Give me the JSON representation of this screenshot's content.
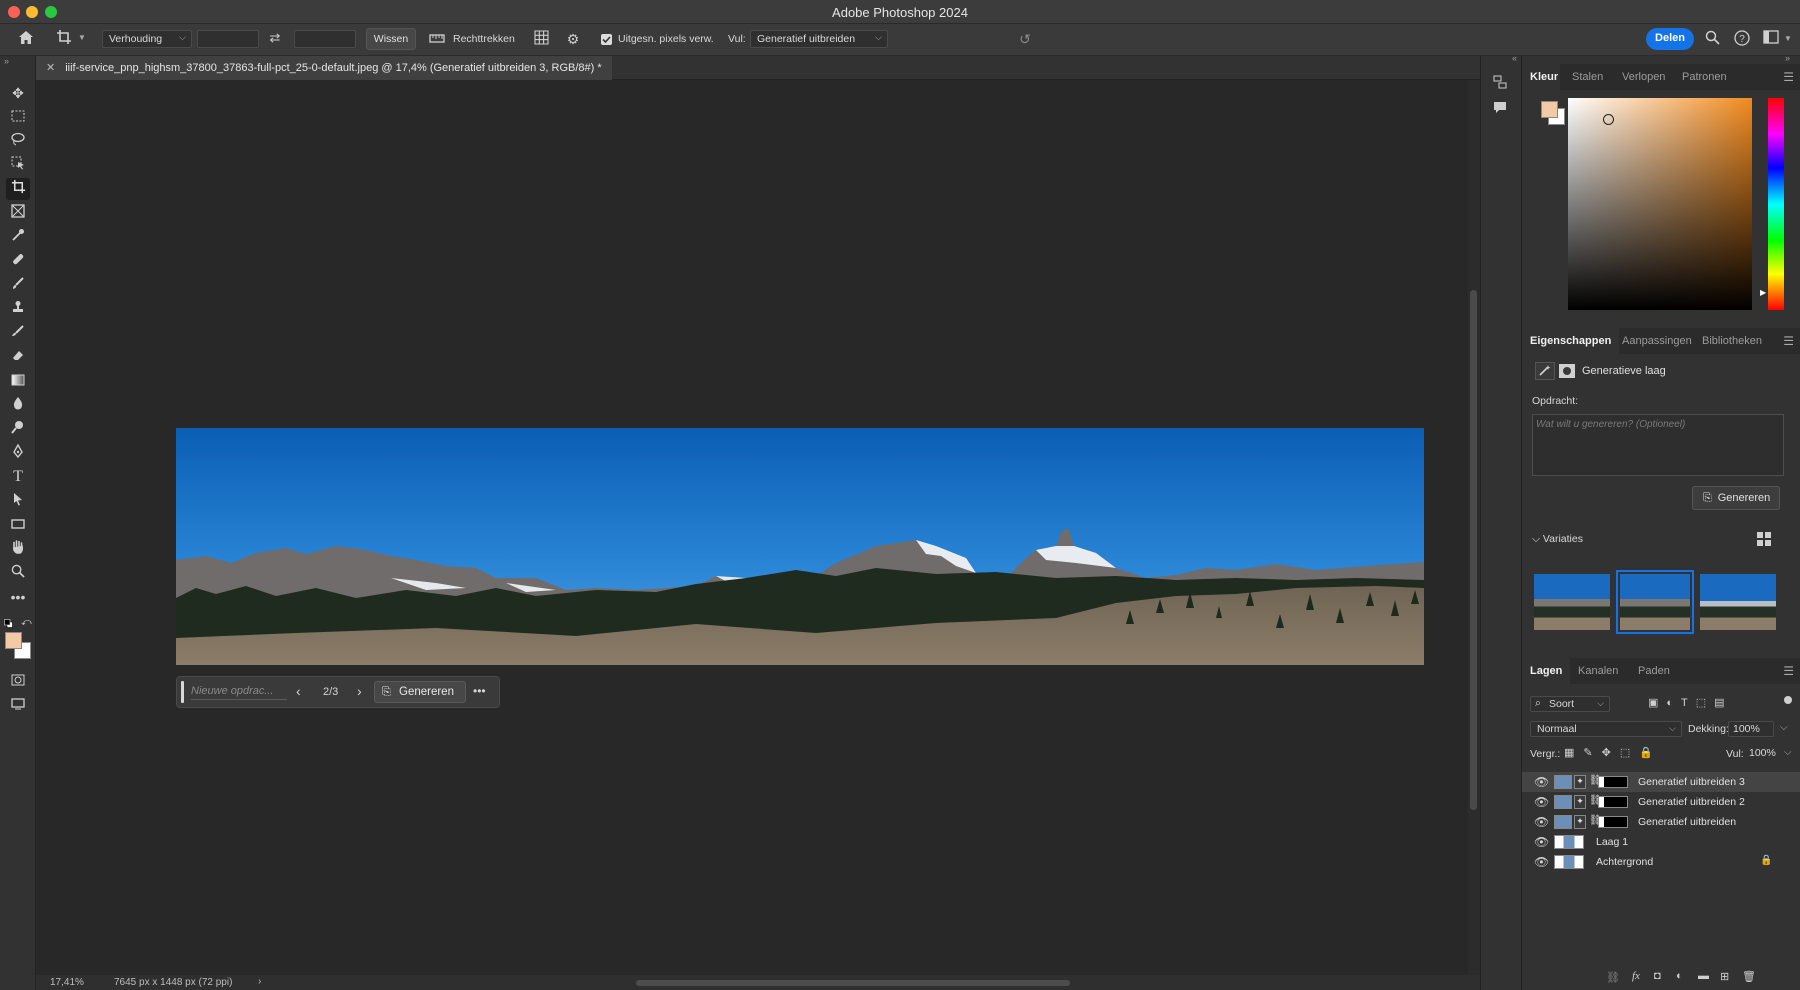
{
  "app": {
    "title": "Adobe Photoshop 2024"
  },
  "options": {
    "ratio": "Verhouding",
    "clear": "Wissen",
    "straighten": "Rechttrekken",
    "delete_pixels": "Uitgesn. pixels verw.",
    "fill_label": "Vul:",
    "fill_value": "Generatief uitbreiden",
    "share": "Delen"
  },
  "document": {
    "tab_title": "iiif-service_pnp_highsm_37800_37863-full-pct_25-0-default.jpeg @ 17,4% (Generatief uitbreiden 3, RGB/8#) *"
  },
  "context_bar": {
    "placeholder": "Nieuwe opdrac...",
    "counter": "2/3",
    "generate": "Genereren"
  },
  "status": {
    "zoom": "17,41%",
    "dims": "7645 px x 1448 px (72 ppi)"
  },
  "color_panel": {
    "tabs": [
      "Kleur",
      "Stalen",
      "Verlopen",
      "Patronen"
    ],
    "foreground": "#f3c9a6",
    "background": "#ffffff"
  },
  "properties_panel": {
    "tabs": [
      "Eigenschappen",
      "Aanpassingen",
      "Bibliotheken"
    ],
    "layer_kind": "Generatieve laag",
    "prompt_label": "Opdracht:",
    "prompt_placeholder": "Wat wilt u genereren? (Optioneel)",
    "generate": "Genereren",
    "variations_label": "Variaties"
  },
  "layers_panel": {
    "tabs": [
      "Lagen",
      "Kanalen",
      "Paden"
    ],
    "filter": "Soort",
    "blend_mode": "Normaal",
    "opacity_label": "Dekking:",
    "opacity": "100%",
    "lock_label": "Vergr.:",
    "fill_label": "Vul:",
    "fill": "100%",
    "layers": [
      {
        "name": "Generatief uitbreiden 3",
        "selected": true
      },
      {
        "name": "Generatief uitbreiden 2",
        "selected": false
      },
      {
        "name": "Generatief uitbreiden",
        "selected": false
      },
      {
        "name": "Laag 1",
        "selected": false
      },
      {
        "name": "Achtergrond",
        "selected": false
      }
    ]
  }
}
